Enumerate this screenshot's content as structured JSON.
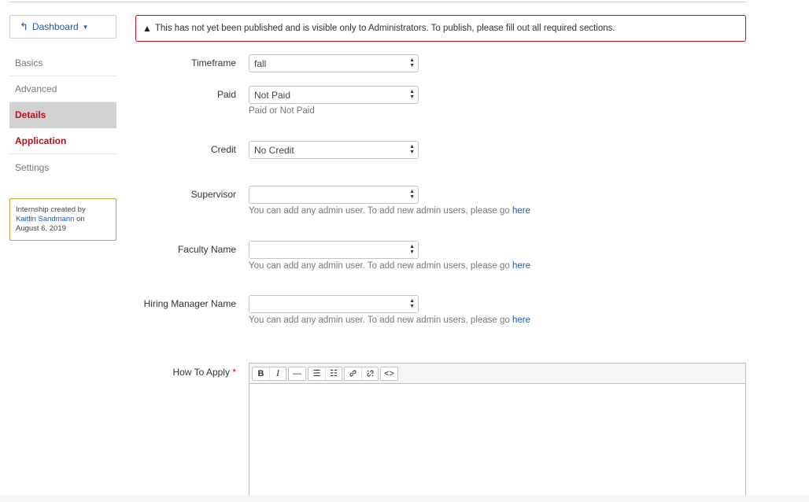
{
  "sidebar": {
    "dashboard_label": "Dashboard",
    "items": [
      {
        "label": "Basics"
      },
      {
        "label": "Advanced"
      },
      {
        "label": "Details"
      },
      {
        "label": "Application"
      },
      {
        "label": "Settings"
      }
    ],
    "created": {
      "prefix": "Internship created by",
      "author": "Kaitlin Sandmann",
      "on": "on",
      "date": "August 6, 2019"
    }
  },
  "alert": {
    "text": "This has not yet been published and is visible only to Administrators. To publish, please fill out all required sections."
  },
  "form": {
    "timeframe": {
      "label": "Timeframe",
      "value": "fall"
    },
    "paid": {
      "label": "Paid",
      "value": "Not Paid",
      "help": "Paid or Not Paid"
    },
    "credit": {
      "label": "Credit",
      "value": "No Credit"
    },
    "supervisor": {
      "label": "Supervisor",
      "value": "",
      "help": "You can add any admin user. To add new admin users, please go",
      "link": "here"
    },
    "faculty": {
      "label": "Faculty Name",
      "value": "",
      "help": "You can add any admin user. To add new admin users, please go",
      "link": "here"
    },
    "hiring": {
      "label": "Hiring Manager Name",
      "value": "",
      "help": "You can add any admin user. To add new admin users, please go",
      "link": "here"
    },
    "how_to_apply": {
      "label": "How To Apply",
      "required_mark": "*"
    }
  },
  "editor": {
    "bold": "B",
    "italic": "I",
    "hr": "—",
    "ul": "☰",
    "ol": "☷",
    "link": "🔗",
    "unlink": "⛓",
    "code": "<>"
  }
}
